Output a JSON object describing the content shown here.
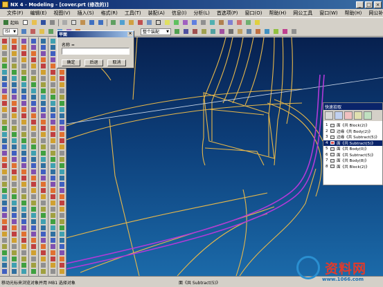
{
  "window": {
    "title": "NX 4 - Modeling - [cover.prt (修改的)]",
    "buttons": [
      "_",
      "□",
      "×"
    ]
  },
  "menu": [
    "文件(F)",
    "编辑(E)",
    "视图(V)",
    "插入(S)",
    "格式(R)",
    "工具(T)",
    "装配(A)",
    "信息(I)",
    "分析(L)",
    "首选项(P)",
    "窗口(O)",
    "帮助(H)",
    "网公工具",
    "窗口(W)",
    "帮助(H)",
    "网公补充"
  ],
  "toolbar": {
    "start_label": "起始",
    "filter_combo": "ISI",
    "view_combo": "整个装配"
  },
  "dialog": {
    "title": "平面",
    "label": "名称 =",
    "name_value": "",
    "ok": "确定",
    "back": "后退",
    "cancel": "取消",
    "close": "×"
  },
  "quick_pick": {
    "title": "快速拾取",
    "items": [
      {
        "num": "1",
        "text": "面《共 Block(2)》"
      },
      {
        "num": "2",
        "text": "边缘《共 Body(2)》"
      },
      {
        "num": "3",
        "text": "边缘《共 Subtract(5)》"
      },
      {
        "num": "4",
        "text": "面《共 Subtract(5)》",
        "selected": true
      },
      {
        "num": "5",
        "text": "面《共 Body(0)》"
      },
      {
        "num": "6",
        "text": "面《共 Subtract(5)》"
      },
      {
        "num": "7",
        "text": "面《共 Body(8)》"
      },
      {
        "num": "8",
        "text": "面《共 Block(2)》"
      }
    ]
  },
  "status": {
    "left": "移动光标来浏览对象并用 MB1 选择对象",
    "right": "面《共 Subtract(5)》"
  },
  "watermark": {
    "cn": "资料网",
    "url": "www.1066.com"
  },
  "colors": {
    "wire": "#e8b84a",
    "highlight": "#b23ad8",
    "viewport_top": "#07204f",
    "viewport_bottom": "#1b6aa9"
  }
}
